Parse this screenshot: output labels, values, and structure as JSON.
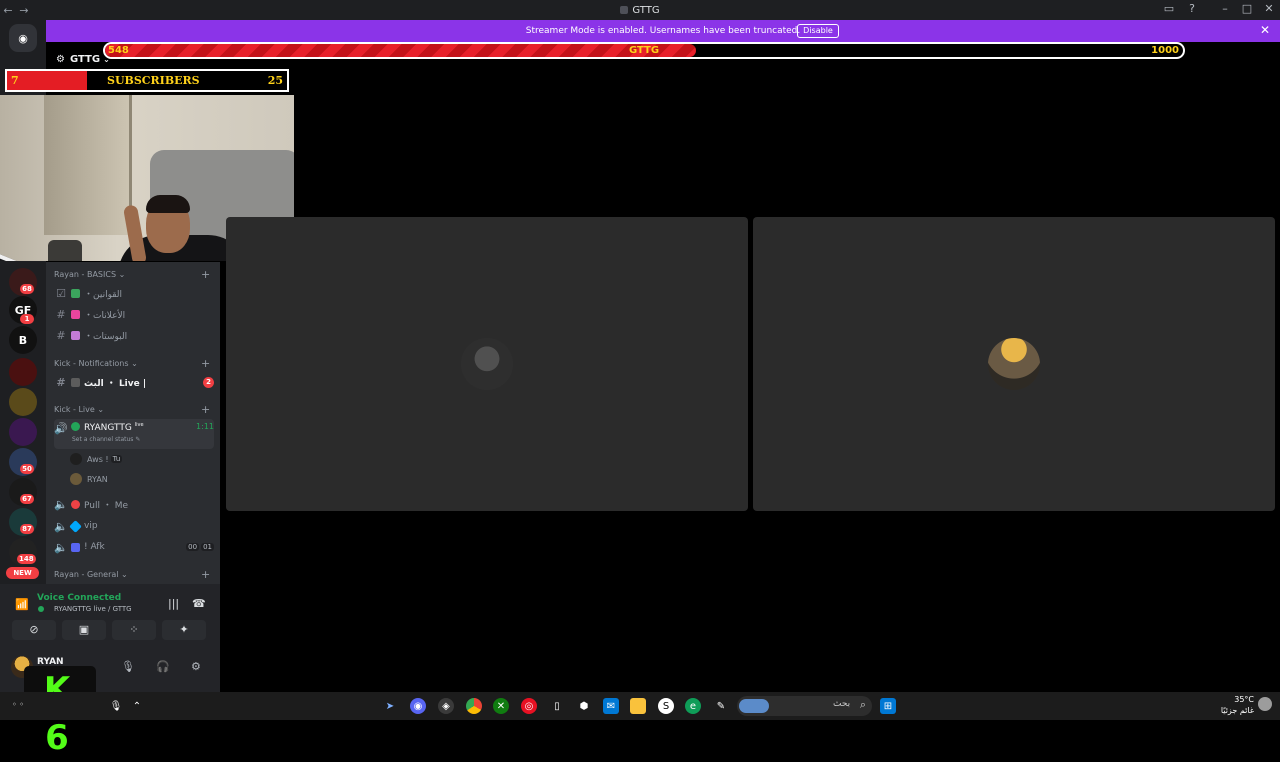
{
  "window": {
    "title": "GTTG",
    "back_icon": "arrow-left-icon",
    "forward_icon": "arrow-right-icon"
  },
  "banner": {
    "message": "Streamer Mode is enabled. Usernames have been truncated.",
    "disable_label": "Disable",
    "color": "#8b34e8"
  },
  "goal_bar": {
    "left_value": "548",
    "center_label": "GTTG",
    "right_value": "1000",
    "progress_fraction": 0.548
  },
  "subs_widget": {
    "left_value": "7",
    "label": "SUBSCRIBERS",
    "right_value": "25"
  },
  "server": {
    "name": "GTTG"
  },
  "rail": {
    "items": [
      {
        "label": "",
        "badge": "68"
      },
      {
        "label": "GF",
        "badge": "1"
      },
      {
        "label": "B",
        "badge": ""
      },
      {
        "label": "",
        "badge": ""
      },
      {
        "label": "",
        "badge": ""
      },
      {
        "label": "",
        "badge": ""
      },
      {
        "label": "",
        "badge": "50"
      },
      {
        "label": "",
        "badge": "67"
      },
      {
        "label": "",
        "badge": "87"
      },
      {
        "label": "",
        "badge": "148"
      }
    ],
    "new_label": "NEW"
  },
  "channels": {
    "categories": [
      {
        "label": "Rayan - BASICS"
      },
      {
        "label": "Kick - Notifications"
      },
      {
        "label": "Kick - Live"
      },
      {
        "label": "Rayan - General"
      }
    ],
    "basics": [
      {
        "name": "・القوانين",
        "icon_color": "#3ba55d"
      },
      {
        "name": "・الأعلانات",
        "icon_color": "#eb459e"
      },
      {
        "name": "・البوستات",
        "icon_color": "#c37bd6"
      }
    ],
    "live_text": {
      "name": "البث ・ Live |",
      "badge": "2",
      "icon_color": "#5c5c5c"
    },
    "voice": {
      "name": "RYANGTTG",
      "suffix": "live",
      "time": "1:11",
      "status": "Set a channel status",
      "members": [
        {
          "name": "Aws !",
          "tag": "Tu"
        },
        {
          "name": "RYAN",
          "tag": ""
        }
      ]
    },
    "other_voice": [
      {
        "name": "Pull ・ Me",
        "icon_color": "#ed4245"
      },
      {
        "name": "vip",
        "icon_color": "#5865f2"
      },
      {
        "name": "! Afk",
        "icon_color": "#5865f2",
        "count_a": "00",
        "count_b": "01"
      }
    ]
  },
  "voice_panel": {
    "status": "Voice Connected",
    "detail": "RYANGTTG live / GTTG"
  },
  "user_panel": {
    "name": "RYAN"
  },
  "overlay_logo": "K 6",
  "taskbar": {
    "search_text": "بحث",
    "weather_temp": "35°C",
    "weather_desc": "غائم جزئيًا"
  },
  "colors": {
    "accent_green": "#23a559",
    "danger_red": "#f23f43",
    "kick_green": "#53fc18"
  }
}
